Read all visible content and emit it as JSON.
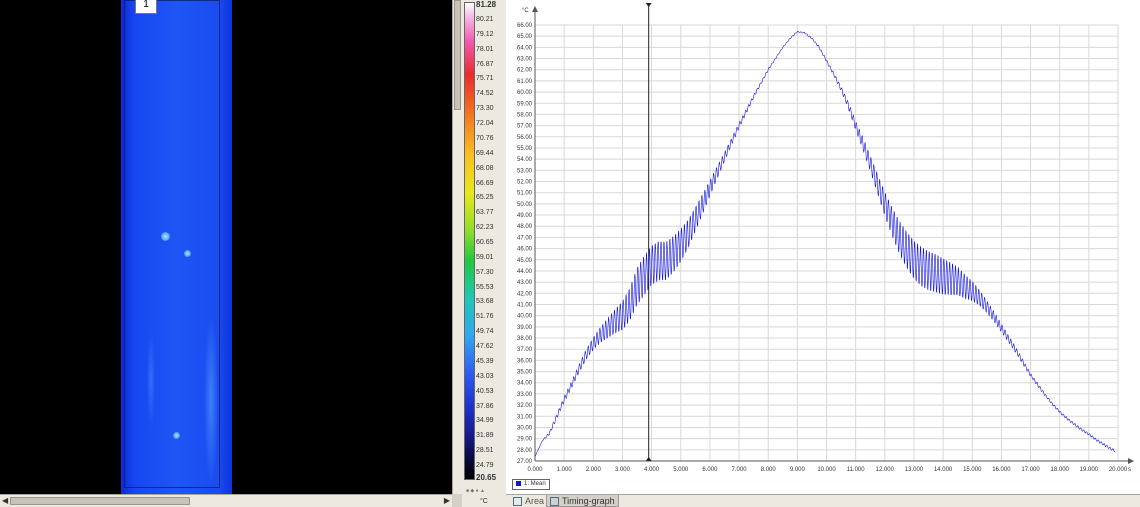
{
  "thermal_image": {
    "roi_label": "1"
  },
  "color_scale": {
    "max_label": "81.28",
    "min_label": "20.65",
    "labels": [
      "80.21",
      "79.12",
      "78.01",
      "76.87",
      "75.71",
      "74.52",
      "73.30",
      "72.04",
      "70.76",
      "69.44",
      "68.08",
      "66.69",
      "65.25",
      "63.77",
      "62.23",
      "60.65",
      "59.01",
      "57.30",
      "55.53",
      "53.68",
      "51.76",
      "49.74",
      "47.62",
      "45.39",
      "43.03",
      "40.53",
      "37.86",
      "34.99",
      "31.89",
      "28.51",
      "24.79"
    ],
    "unit": "°C"
  },
  "graph": {
    "legend_label": "1: Mean",
    "legend_color": "#1414d8"
  },
  "tabs": [
    {
      "label": "Area",
      "icon": "area-icon"
    },
    {
      "label": "Timing-graph",
      "icon": "timing-graph-icon"
    }
  ],
  "chart_data": {
    "type": "line",
    "ylabel": "°C",
    "xlabel": "s",
    "xlim": [
      0,
      20
    ],
    "ylim": [
      27,
      66
    ],
    "grid": true,
    "x_ticks": [
      "0.000",
      "1.000",
      "2.000",
      "3.000",
      "4.000",
      "5.000",
      "6.000",
      "7.000",
      "8.000",
      "9.000",
      "10.000",
      "11.000",
      "12.000",
      "13.000",
      "14.000",
      "15.000",
      "16.000",
      "17.000",
      "18.000",
      "19.000",
      "20.000"
    ],
    "y_ticks": [
      "27.00",
      "28.00",
      "29.00",
      "30.00",
      "31.00",
      "32.00",
      "33.00",
      "34.00",
      "35.00",
      "36.00",
      "37.00",
      "38.00",
      "39.00",
      "40.00",
      "41.00",
      "42.00",
      "43.00",
      "44.00",
      "45.00",
      "46.00",
      "47.00",
      "48.00",
      "49.00",
      "50.00",
      "51.00",
      "52.00",
      "53.00",
      "54.00",
      "55.00",
      "56.00",
      "57.00",
      "58.00",
      "59.00",
      "60.00",
      "61.00",
      "62.00",
      "63.00",
      "64.00",
      "65.00",
      "66.00"
    ],
    "cursor_x": 3.9,
    "series": [
      {
        "name": "1: Mean",
        "color": "#1414d8",
        "x": [
          0.0,
          0.25,
          0.5,
          0.75,
          1.0,
          1.25,
          1.5,
          1.75,
          2.0,
          2.25,
          2.5,
          2.75,
          3.0,
          3.25,
          3.5,
          3.75,
          4.0,
          4.25,
          4.5,
          4.75,
          5.0,
          5.25,
          5.5,
          5.75,
          6.0,
          6.25,
          6.5,
          6.75,
          7.0,
          7.25,
          7.5,
          7.75,
          8.0,
          8.25,
          8.5,
          8.75,
          9.0,
          9.25,
          9.5,
          9.75,
          10.0,
          10.25,
          10.5,
          10.75,
          11.0,
          11.25,
          11.5,
          11.75,
          12.0,
          12.25,
          12.5,
          12.75,
          13.0,
          13.25,
          13.5,
          13.75,
          14.0,
          14.25,
          14.5,
          14.75,
          15.0,
          15.25,
          15.5,
          15.75,
          16.0,
          16.25,
          16.5,
          16.75,
          17.0,
          17.25,
          17.5,
          17.75,
          18.0,
          18.25,
          18.5,
          18.75,
          19.0,
          19.25,
          19.5,
          19.75,
          20.0
        ],
        "y": [
          27.4,
          28.8,
          29.5,
          31.0,
          32.5,
          33.8,
          35.2,
          36.5,
          37.5,
          38.3,
          38.9,
          39.5,
          40.0,
          41.0,
          42.6,
          43.6,
          44.5,
          44.9,
          44.9,
          45.5,
          46.3,
          47.3,
          48.6,
          50.0,
          51.4,
          52.8,
          54.2,
          55.6,
          57.0,
          58.3,
          59.6,
          60.8,
          62.0,
          63.0,
          64.0,
          64.8,
          65.4,
          65.3,
          64.8,
          64.0,
          62.8,
          61.6,
          60.3,
          58.8,
          57.0,
          55.4,
          53.6,
          51.8,
          50.0,
          48.4,
          47.0,
          45.9,
          45.0,
          44.4,
          44.0,
          43.8,
          43.5,
          43.3,
          43.1,
          42.6,
          42.2,
          41.6,
          40.8,
          39.9,
          38.9,
          37.9,
          36.9,
          35.8,
          34.7,
          33.8,
          32.9,
          32.1,
          31.4,
          30.8,
          30.3,
          29.8,
          29.4,
          28.9,
          28.5,
          28.1,
          27.8
        ],
        "oscillation_amplitude": [
          0.0,
          0.0,
          0.3,
          0.4,
          0.5,
          0.6,
          0.7,
          0.9,
          1.1,
          1.4,
          1.8,
          2.2,
          2.6,
          3.0,
          3.4,
          3.6,
          3.6,
          3.6,
          3.5,
          3.3,
          3.0,
          2.6,
          2.2,
          1.8,
          1.4,
          1.1,
          0.8,
          0.6,
          0.5,
          0.4,
          0.3,
          0.2,
          0.2,
          0.1,
          0.1,
          0.1,
          0.1,
          0.1,
          0.1,
          0.2,
          0.2,
          0.3,
          0.4,
          0.6,
          0.8,
          1.1,
          1.4,
          1.8,
          2.2,
          2.6,
          3.0,
          3.3,
          3.5,
          3.6,
          3.6,
          3.5,
          3.3,
          3.0,
          2.6,
          2.2,
          1.8,
          1.4,
          1.1,
          0.9,
          0.7,
          0.6,
          0.5,
          0.4,
          0.3,
          0.3,
          0.2,
          0.2,
          0.2,
          0.2,
          0.2,
          0.2,
          0.2,
          0.2,
          0.2,
          0.2,
          0.2
        ]
      }
    ]
  }
}
